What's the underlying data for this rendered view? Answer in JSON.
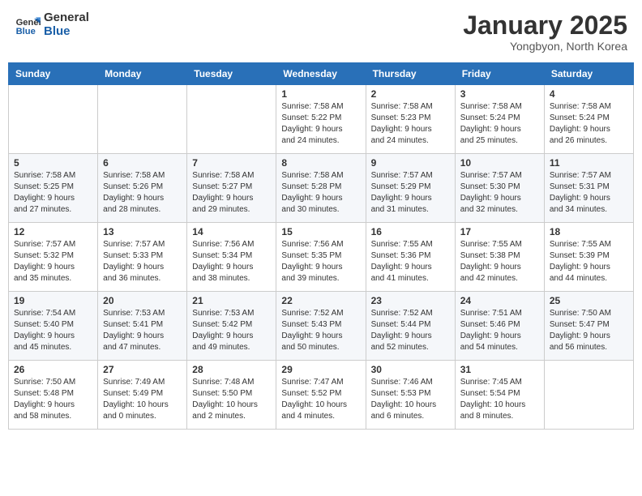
{
  "header": {
    "logo_line1": "General",
    "logo_line2": "Blue",
    "month": "January 2025",
    "location": "Yongbyon, North Korea"
  },
  "weekdays": [
    "Sunday",
    "Monday",
    "Tuesday",
    "Wednesday",
    "Thursday",
    "Friday",
    "Saturday"
  ],
  "weeks": [
    [
      {
        "day": "",
        "info": ""
      },
      {
        "day": "",
        "info": ""
      },
      {
        "day": "",
        "info": ""
      },
      {
        "day": "1",
        "info": "Sunrise: 7:58 AM\nSunset: 5:22 PM\nDaylight: 9 hours\nand 24 minutes."
      },
      {
        "day": "2",
        "info": "Sunrise: 7:58 AM\nSunset: 5:23 PM\nDaylight: 9 hours\nand 24 minutes."
      },
      {
        "day": "3",
        "info": "Sunrise: 7:58 AM\nSunset: 5:24 PM\nDaylight: 9 hours\nand 25 minutes."
      },
      {
        "day": "4",
        "info": "Sunrise: 7:58 AM\nSunset: 5:24 PM\nDaylight: 9 hours\nand 26 minutes."
      }
    ],
    [
      {
        "day": "5",
        "info": "Sunrise: 7:58 AM\nSunset: 5:25 PM\nDaylight: 9 hours\nand 27 minutes."
      },
      {
        "day": "6",
        "info": "Sunrise: 7:58 AM\nSunset: 5:26 PM\nDaylight: 9 hours\nand 28 minutes."
      },
      {
        "day": "7",
        "info": "Sunrise: 7:58 AM\nSunset: 5:27 PM\nDaylight: 9 hours\nand 29 minutes."
      },
      {
        "day": "8",
        "info": "Sunrise: 7:58 AM\nSunset: 5:28 PM\nDaylight: 9 hours\nand 30 minutes."
      },
      {
        "day": "9",
        "info": "Sunrise: 7:57 AM\nSunset: 5:29 PM\nDaylight: 9 hours\nand 31 minutes."
      },
      {
        "day": "10",
        "info": "Sunrise: 7:57 AM\nSunset: 5:30 PM\nDaylight: 9 hours\nand 32 minutes."
      },
      {
        "day": "11",
        "info": "Sunrise: 7:57 AM\nSunset: 5:31 PM\nDaylight: 9 hours\nand 34 minutes."
      }
    ],
    [
      {
        "day": "12",
        "info": "Sunrise: 7:57 AM\nSunset: 5:32 PM\nDaylight: 9 hours\nand 35 minutes."
      },
      {
        "day": "13",
        "info": "Sunrise: 7:57 AM\nSunset: 5:33 PM\nDaylight: 9 hours\nand 36 minutes."
      },
      {
        "day": "14",
        "info": "Sunrise: 7:56 AM\nSunset: 5:34 PM\nDaylight: 9 hours\nand 38 minutes."
      },
      {
        "day": "15",
        "info": "Sunrise: 7:56 AM\nSunset: 5:35 PM\nDaylight: 9 hours\nand 39 minutes."
      },
      {
        "day": "16",
        "info": "Sunrise: 7:55 AM\nSunset: 5:36 PM\nDaylight: 9 hours\nand 41 minutes."
      },
      {
        "day": "17",
        "info": "Sunrise: 7:55 AM\nSunset: 5:38 PM\nDaylight: 9 hours\nand 42 minutes."
      },
      {
        "day": "18",
        "info": "Sunrise: 7:55 AM\nSunset: 5:39 PM\nDaylight: 9 hours\nand 44 minutes."
      }
    ],
    [
      {
        "day": "19",
        "info": "Sunrise: 7:54 AM\nSunset: 5:40 PM\nDaylight: 9 hours\nand 45 minutes."
      },
      {
        "day": "20",
        "info": "Sunrise: 7:53 AM\nSunset: 5:41 PM\nDaylight: 9 hours\nand 47 minutes."
      },
      {
        "day": "21",
        "info": "Sunrise: 7:53 AM\nSunset: 5:42 PM\nDaylight: 9 hours\nand 49 minutes."
      },
      {
        "day": "22",
        "info": "Sunrise: 7:52 AM\nSunset: 5:43 PM\nDaylight: 9 hours\nand 50 minutes."
      },
      {
        "day": "23",
        "info": "Sunrise: 7:52 AM\nSunset: 5:44 PM\nDaylight: 9 hours\nand 52 minutes."
      },
      {
        "day": "24",
        "info": "Sunrise: 7:51 AM\nSunset: 5:46 PM\nDaylight: 9 hours\nand 54 minutes."
      },
      {
        "day": "25",
        "info": "Sunrise: 7:50 AM\nSunset: 5:47 PM\nDaylight: 9 hours\nand 56 minutes."
      }
    ],
    [
      {
        "day": "26",
        "info": "Sunrise: 7:50 AM\nSunset: 5:48 PM\nDaylight: 9 hours\nand 58 minutes."
      },
      {
        "day": "27",
        "info": "Sunrise: 7:49 AM\nSunset: 5:49 PM\nDaylight: 10 hours\nand 0 minutes."
      },
      {
        "day": "28",
        "info": "Sunrise: 7:48 AM\nSunset: 5:50 PM\nDaylight: 10 hours\nand 2 minutes."
      },
      {
        "day": "29",
        "info": "Sunrise: 7:47 AM\nSunset: 5:52 PM\nDaylight: 10 hours\nand 4 minutes."
      },
      {
        "day": "30",
        "info": "Sunrise: 7:46 AM\nSunset: 5:53 PM\nDaylight: 10 hours\nand 6 minutes."
      },
      {
        "day": "31",
        "info": "Sunrise: 7:45 AM\nSunset: 5:54 PM\nDaylight: 10 hours\nand 8 minutes."
      },
      {
        "day": "",
        "info": ""
      }
    ]
  ]
}
